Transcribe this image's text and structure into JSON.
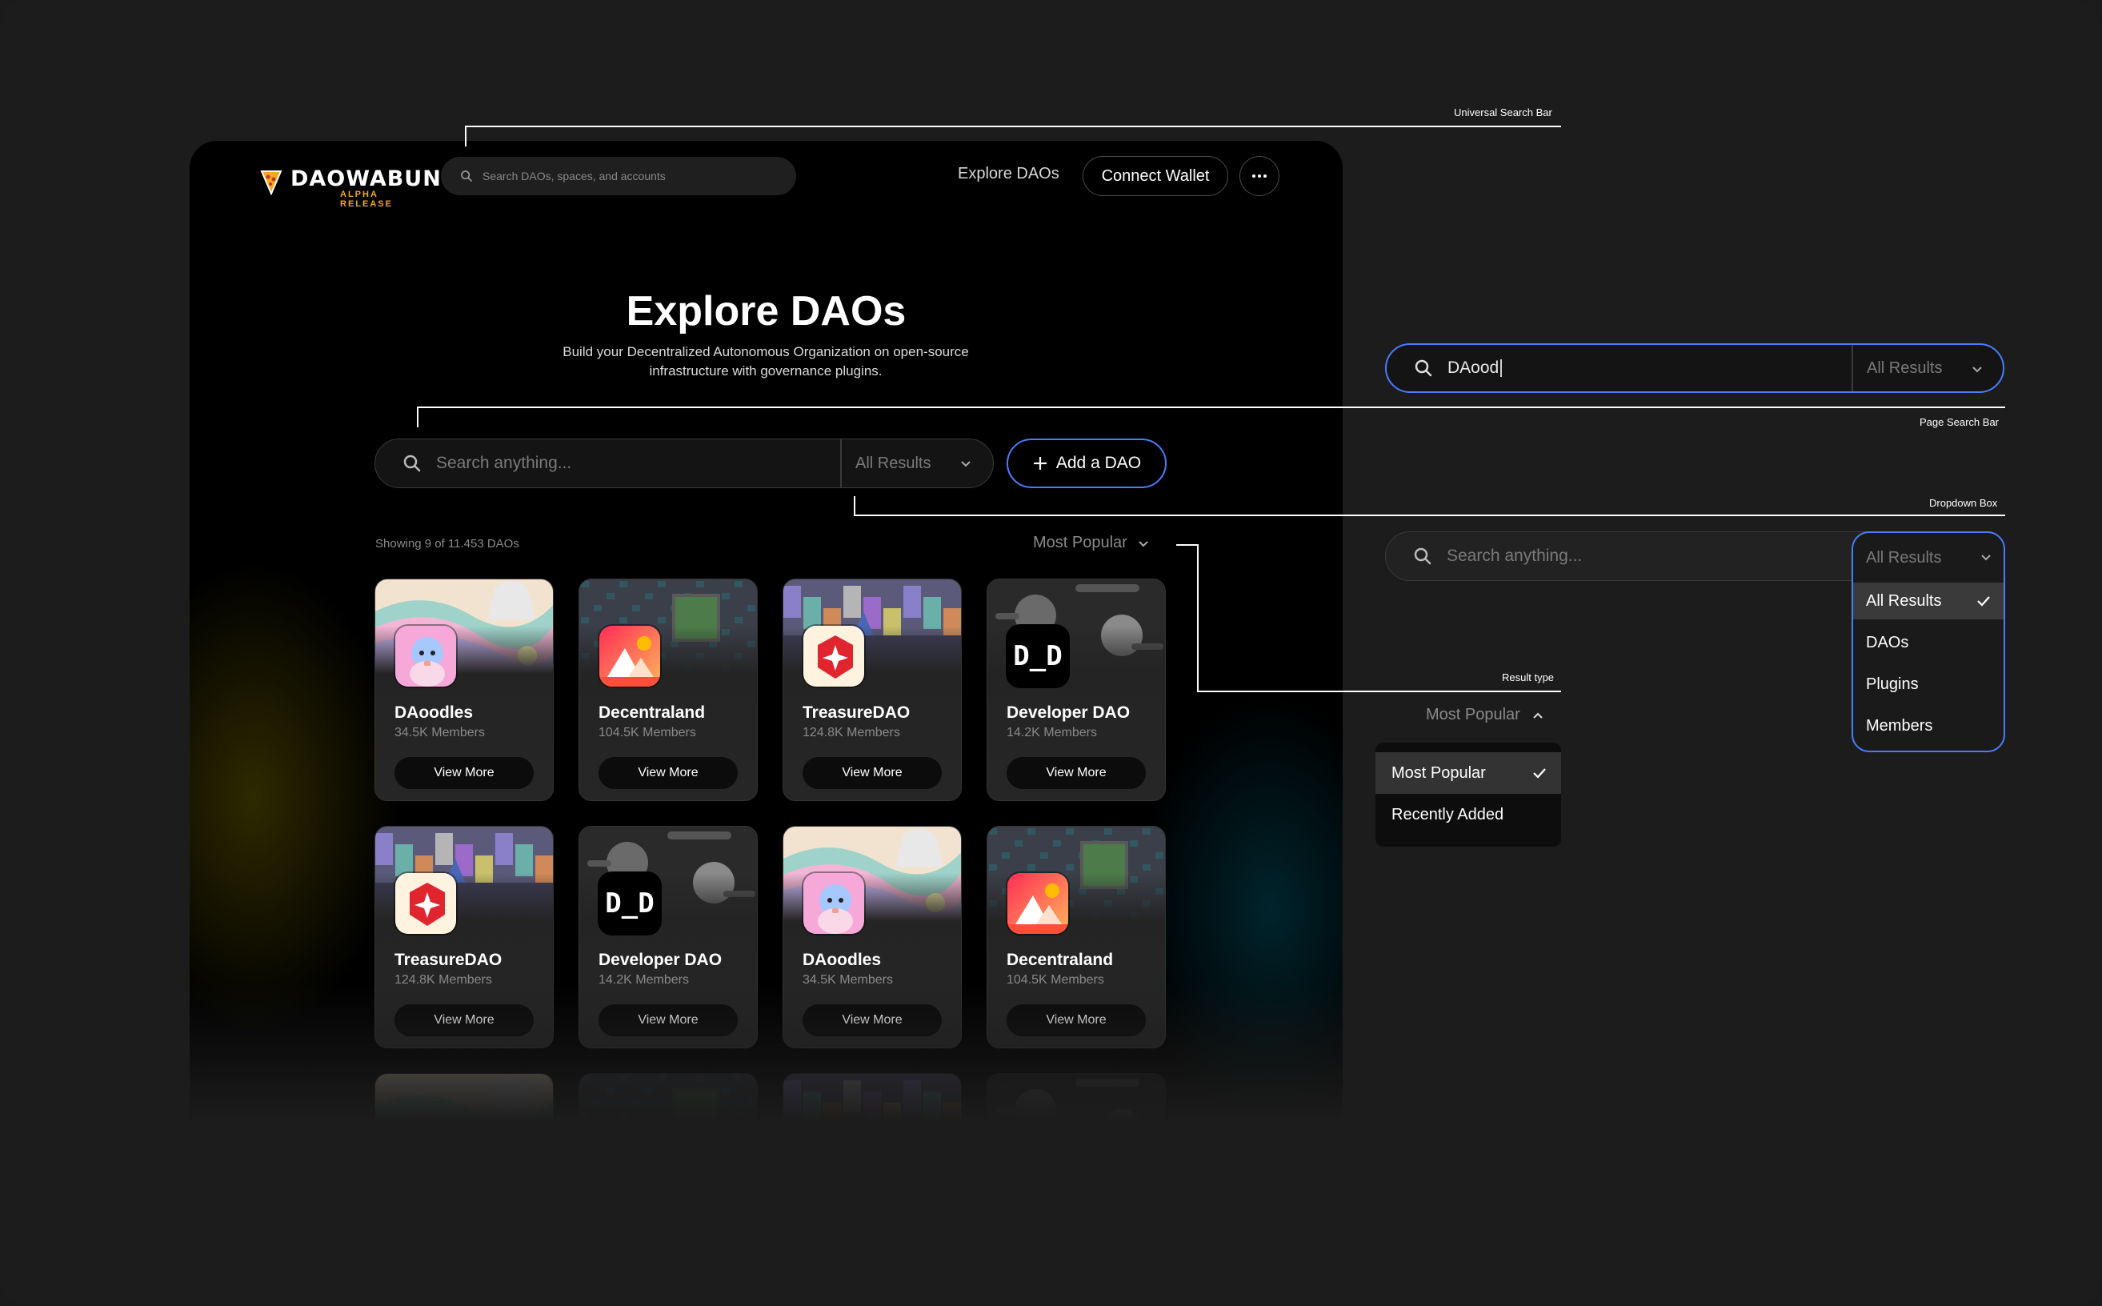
{
  "header": {
    "logo_text": "DAOWABUNGA",
    "logo_sub": "ALPHA RELEASE",
    "search_placeholder": "Search DAOs, spaces, and accounts",
    "nav_explore": "Explore DAOs",
    "connect_wallet": "Connect Wallet",
    "more_icon": "ellipsis-icon"
  },
  "hero": {
    "title": "Explore DAOs",
    "subtitle": "Build your Decentralized Autonomous Organization on open-source infrastructure with governance plugins."
  },
  "page_search": {
    "placeholder": "Search anything...",
    "filter_value": "All Results",
    "add_button": "Add a DAO"
  },
  "results": {
    "showing": "Showing 9 of 11.453 DAOs",
    "sort_value": "Most Popular"
  },
  "cards": [
    {
      "name": "DAoodles",
      "members": "34.5K Members",
      "button": "View More",
      "art": "doodles"
    },
    {
      "name": "Decentraland",
      "members": "104.5K Members",
      "button": "View More",
      "art": "decentraland"
    },
    {
      "name": "TreasureDAO",
      "members": "124.8K Members",
      "button": "View More",
      "art": "treasure"
    },
    {
      "name": "Developer DAO",
      "members": "14.2K Members",
      "button": "View More",
      "art": "devdao"
    },
    {
      "name": "TreasureDAO",
      "members": "124.8K Members",
      "button": "View More",
      "art": "treasure"
    },
    {
      "name": "Developer DAO",
      "members": "14.2K Members",
      "button": "View More",
      "art": "devdao"
    },
    {
      "name": "DAoodles",
      "members": "34.5K Members",
      "button": "View More",
      "art": "doodles"
    },
    {
      "name": "Decentraland",
      "members": "104.5K Members",
      "button": "View More",
      "art": "decentraland"
    }
  ],
  "devdao_mark": "D_D",
  "annotations": {
    "universal_search": "Universal Search Bar",
    "page_search": "Page Search Bar",
    "dropdown_box": "Dropdown Box",
    "result_type": "Result type"
  },
  "demo_search": {
    "typed_value": "DAood",
    "filter_value": "All Results"
  },
  "demo_dropdown": {
    "placeholder": "Search anything...",
    "filter_value": "All Results",
    "options": [
      "All Results",
      "DAOs",
      "Plugins",
      "Members"
    ],
    "selected": "All Results"
  },
  "demo_sort": {
    "value": "Most Popular",
    "options": [
      "Most Popular",
      "Recently Added"
    ],
    "selected": "Most Popular"
  },
  "colors": {
    "accent": "#4a7cff",
    "background": "#1c1c1c",
    "app_background": "#000000",
    "card_background": "#242424",
    "logo_accent": "#f5a623"
  }
}
